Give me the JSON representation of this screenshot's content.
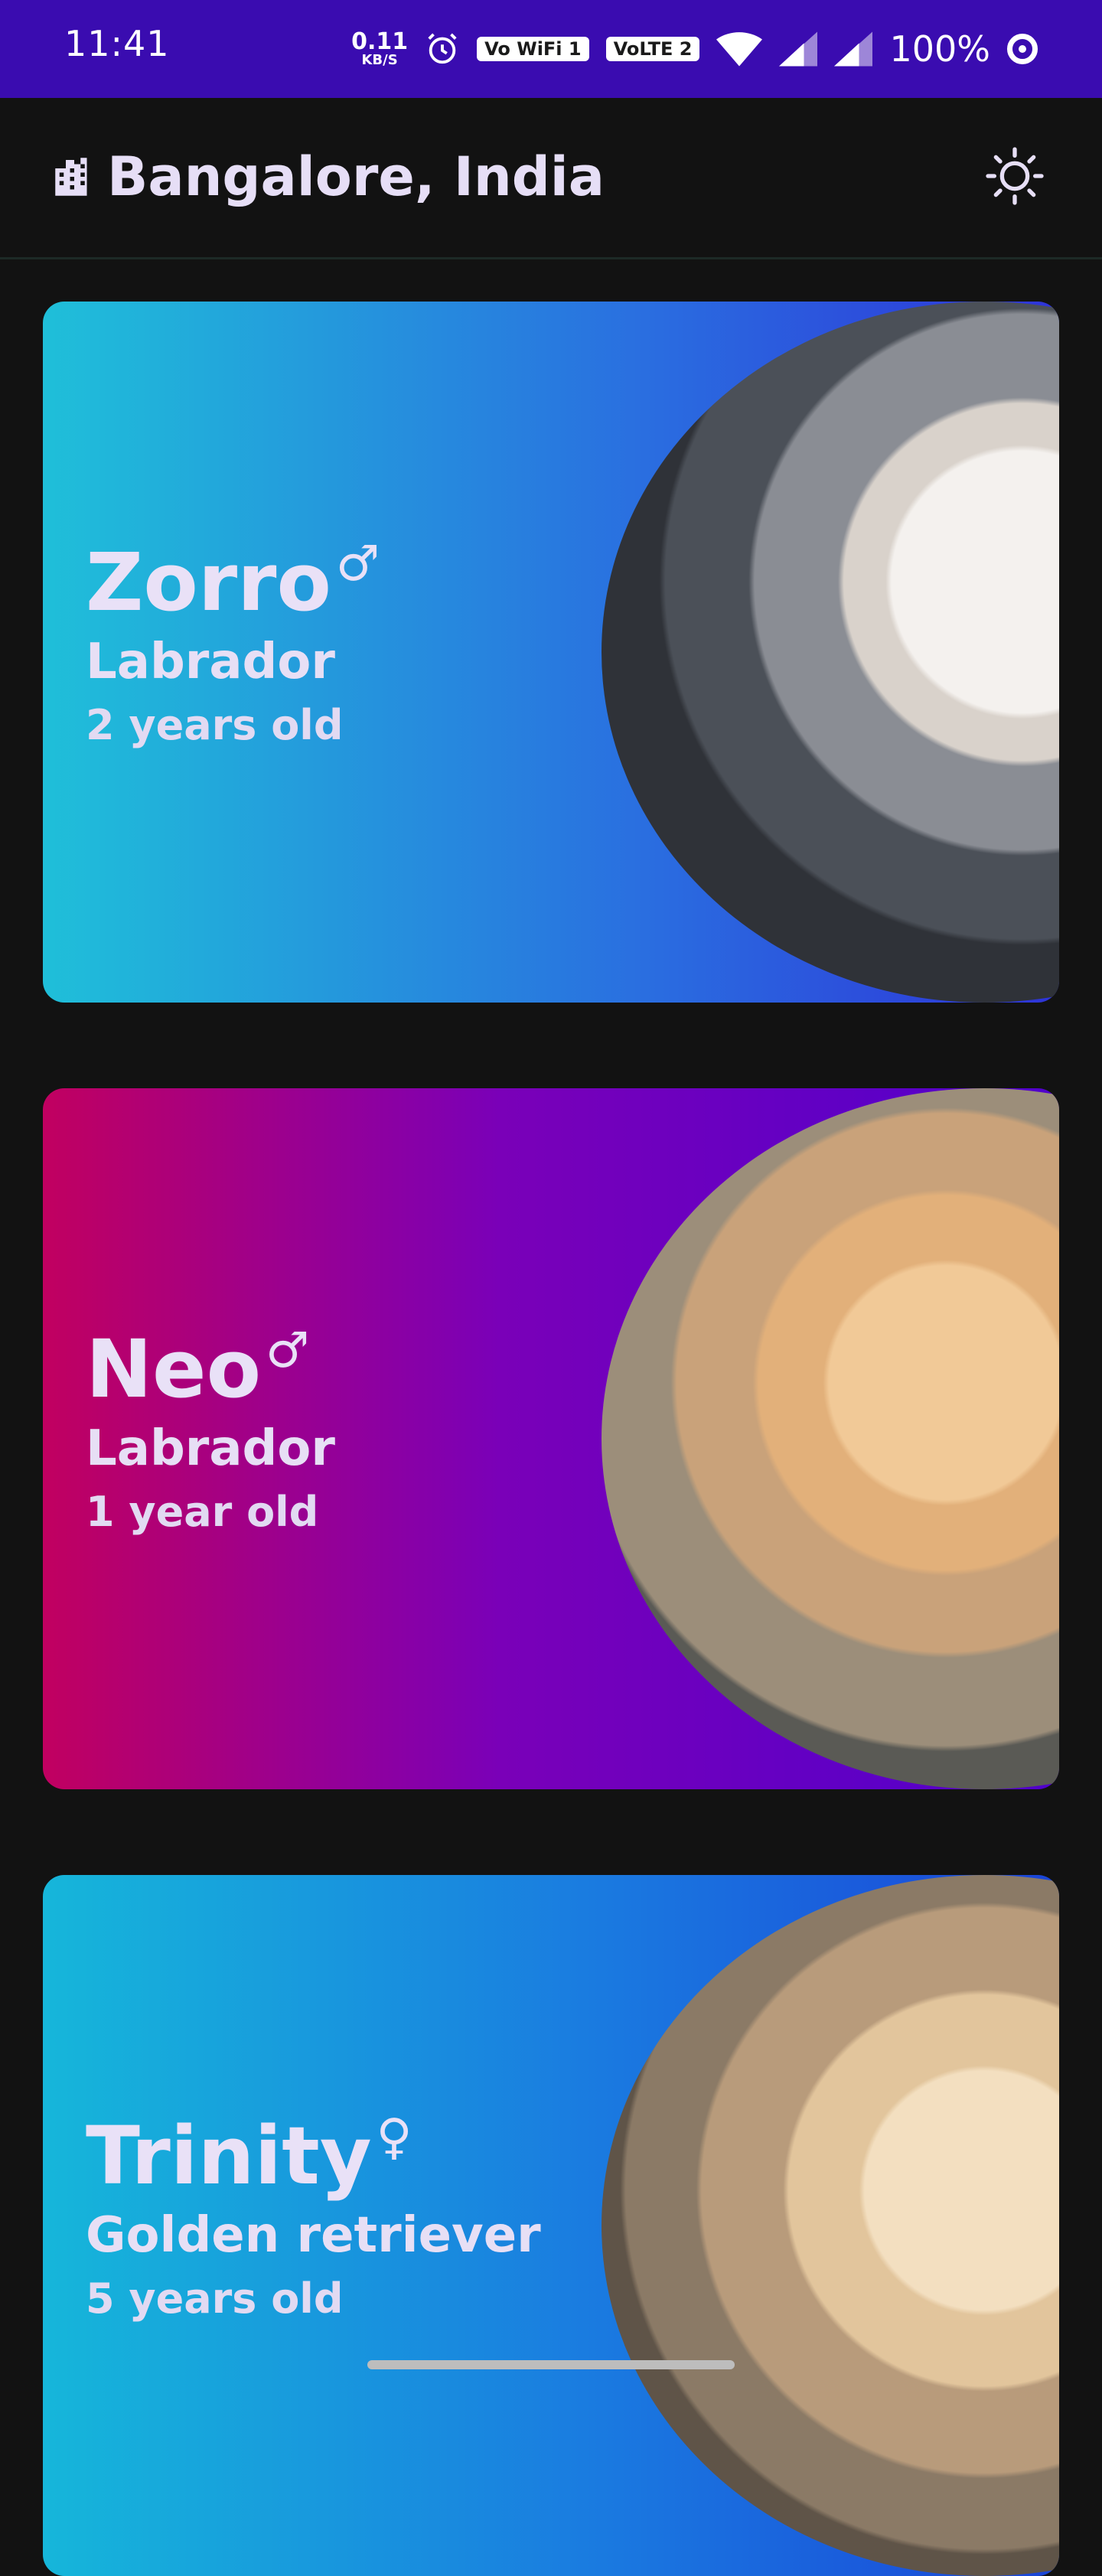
{
  "status_bar": {
    "time": "11:41",
    "speed_value": "0.11",
    "speed_unit": "KB/S",
    "wifi_badge": "Vo WiFi 1",
    "lte_badge": "VoLTE 2",
    "battery": "100%"
  },
  "app_bar": {
    "location": "Bangalore, India",
    "location_icon": "city-icon",
    "theme_icon": "sun-icon"
  },
  "pets": [
    {
      "name": "Zorro",
      "gender_symbol": "♂",
      "breed": "Labrador",
      "age": "2 years old"
    },
    {
      "name": "Neo",
      "gender_symbol": "♂",
      "breed": "Labrador",
      "age": "1 year old"
    },
    {
      "name": "Trinity",
      "gender_symbol": "♀",
      "breed": "Golden retriever",
      "age": "5 years old"
    }
  ],
  "colors": {
    "status_bar": "#3a0cb0",
    "background": "#121212",
    "card_1_start": "#1fbfd9",
    "card_1_end": "#2e33d8",
    "card_2_start": "#c10060",
    "card_2_end": "#5000cc",
    "card_3_start": "#16b6da",
    "card_3_end": "#1a44d8"
  }
}
